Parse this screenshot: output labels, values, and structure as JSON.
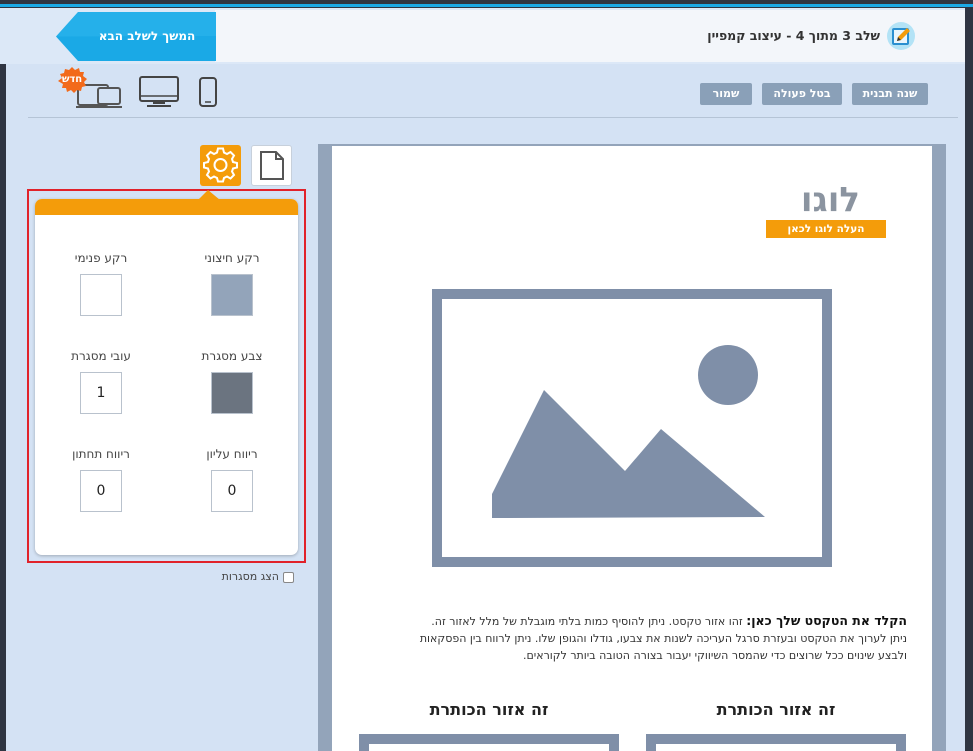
{
  "header": {
    "next_step_label": "המשך לשלב הבא",
    "step_title": "שלב 3 מתוך 4 - עיצוב קמפיין"
  },
  "toolbar": {
    "change_template": "שנה תבנית",
    "undo": "בטל פעולה",
    "save": "שמור",
    "new_badge": "חדש"
  },
  "panel": {
    "outer_bg_label": "רקע חיצוני",
    "inner_bg_label": "רקע פנימי",
    "border_color_label": "צבע מסגרת",
    "border_width_label": "עובי מסגרת",
    "border_width_value": "1",
    "top_padding_label": "ריווח עליון",
    "top_padding_value": "0",
    "bottom_padding_label": "ריווח תחתון",
    "bottom_padding_value": "0",
    "show_frames_label": "הצג מסגרות",
    "colors": {
      "outer_bg": "#93a4ba",
      "inner_bg": "#ffffff",
      "border": "#6b7480"
    }
  },
  "canvas": {
    "logo_text": "לוגו",
    "logo_upload": "העלה לוגו לכאן",
    "text_bold": "הקלד את הטקסט שלך כאן:",
    "text_line1": " זהו אזור טקסט. ניתן להוסיף כמות בלתי מוגבלת של מלל לאזור זה.",
    "text_line2": "ניתן לערוך את הטקסט ובעזרת סרגל העריכה לשנות את צבעו, גודלו והגופן שלו. ניתן לרווח בין הפסקאות",
    "text_line3": "ולבצע שינוים ככל שרוצים כדי שהמסר השיווקי יעבור בצורה הטובה ביותר לקוראים.",
    "col_title_right": "זה אזור הכותרת",
    "col_title_left": "זה אזור הכותרת"
  },
  "colors": {
    "accent": "#f49c0a",
    "next_button": "#1aa9e6",
    "frame": "#7f8fa8",
    "highlight": "#e1222a"
  }
}
